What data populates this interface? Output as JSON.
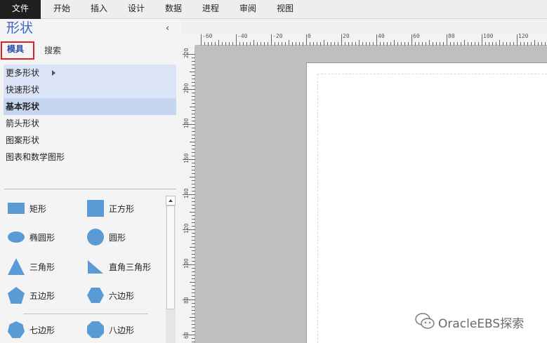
{
  "menubar": {
    "items": [
      {
        "label": "文件",
        "active": true
      },
      {
        "label": "开始"
      },
      {
        "label": "插入"
      },
      {
        "label": "设计"
      },
      {
        "label": "数据"
      },
      {
        "label": "进程"
      },
      {
        "label": "审阅"
      },
      {
        "label": "视图"
      }
    ]
  },
  "panel": {
    "title": "形状",
    "collapse_glyph": "‹",
    "tabs": [
      {
        "label": "模具"
      },
      {
        "label": "搜索"
      }
    ],
    "categories": [
      {
        "label": "更多形状"
      },
      {
        "label": "快速形状"
      },
      {
        "label": "基本形状"
      },
      {
        "label": "箭头形状"
      },
      {
        "label": "图案形状"
      },
      {
        "label": "图表和数学图形"
      }
    ],
    "shapes": [
      {
        "label": "矩形",
        "icon": "rectangle-icon"
      },
      {
        "label": "正方形",
        "icon": "square-icon"
      },
      {
        "label": "椭圆形",
        "icon": "ellipse-icon"
      },
      {
        "label": "圆形",
        "icon": "circle-icon"
      },
      {
        "label": "三角形",
        "icon": "triangle-icon"
      },
      {
        "label": "直角三角形",
        "icon": "right-triangle-icon"
      },
      {
        "label": "五边形",
        "icon": "pentagon-icon"
      },
      {
        "label": "六边形",
        "icon": "hexagon-icon"
      },
      {
        "label": "七边形",
        "icon": "heptagon-icon"
      },
      {
        "label": "八边形",
        "icon": "octagon-icon"
      }
    ],
    "shape_color": "#5b9bd5"
  },
  "ruler": {
    "h_labels": [
      "-60",
      "-40",
      "-20",
      "0",
      "20",
      "40",
      "60",
      "80",
      "100",
      "120"
    ],
    "v_labels": [
      "220",
      "200",
      "180",
      "160",
      "140",
      "120",
      "100",
      "80",
      "60"
    ]
  },
  "watermark": {
    "text": "OracleEBS探索"
  }
}
